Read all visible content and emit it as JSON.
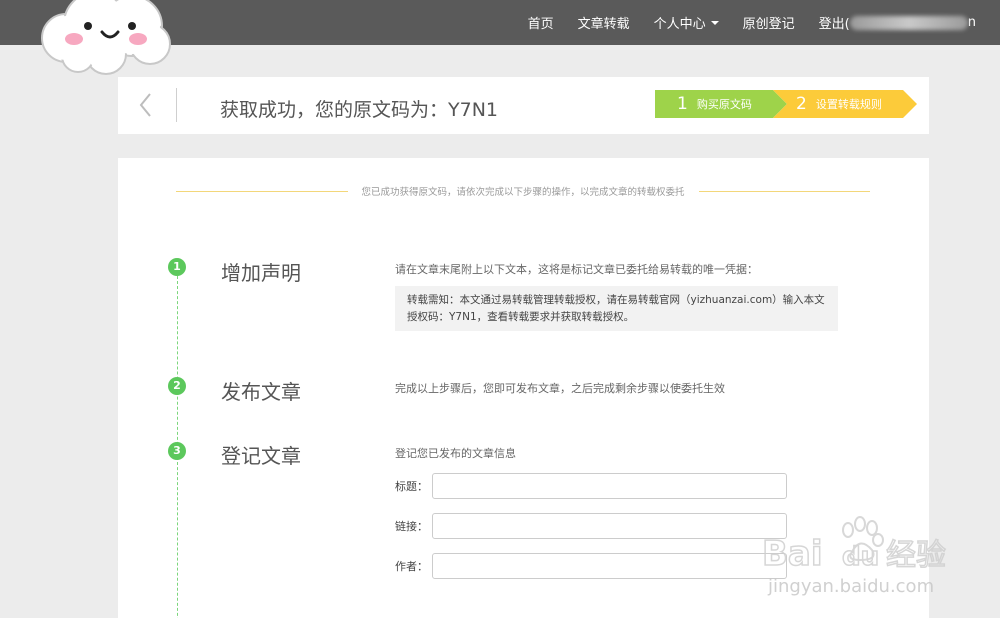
{
  "nav": {
    "items": [
      "首页",
      "文章转载",
      "个人中心",
      "原创登记"
    ],
    "logout_label": "登出(",
    "logout_tail": "n"
  },
  "header": {
    "title": "获取成功，您的原文码为：Y7N1",
    "steps": [
      {
        "num": "1",
        "label": "购买原文码",
        "color": "#9ed34a"
      },
      {
        "num": "2",
        "label": "设置转载规则",
        "color": "#fccb3a"
      }
    ]
  },
  "main": {
    "intro": "您已成功获得原文码，请依次完成以下步骤的操作，以完成文章的转载权委托",
    "steps": [
      {
        "num": "1",
        "title": "增加声明",
        "desc": "请在文章末尾附上以下文本，这将是标记文章已委托给易转载的唯一凭据："
      },
      {
        "num": "2",
        "title": "发布文章",
        "desc": "完成以上步骤后，您即可发布文章，之后完成剩余步骤以使委托生效"
      },
      {
        "num": "3",
        "title": "登记文章",
        "desc": "登记您已发布的文章信息"
      }
    ],
    "notice_line1": "转载需知：本文通过易转载管理转载授权，请在易转载官网（yizhuanzai.com）输入本文",
    "notice_line2": "授权码：Y7N1，查看转载要求并获取转载授权。",
    "form": {
      "title_label": "标题：",
      "link_label": "链接：",
      "author_label": "作者："
    }
  },
  "watermark": {
    "brand": "Bai",
    "brand2": "du",
    "product": "经验",
    "url": "jingyan.baidu.com"
  },
  "colors": {
    "nav_bg": "#5a5a5a",
    "step_green": "#5cc85c",
    "step1_arrow": "#9ed34a",
    "step2_arrow": "#fccb3a"
  }
}
